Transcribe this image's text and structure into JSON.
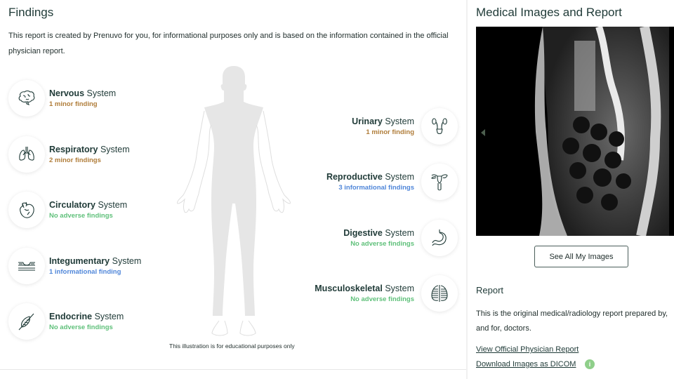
{
  "findings": {
    "title": "Findings",
    "intro": "This report is created by Prenuvo for you, for informational purposes only and is based on the information contained in the official physician report.",
    "illustration_caption": "This illustration is for educational purposes only",
    "systems": [
      {
        "name": "Nervous",
        "suffix": " System",
        "status": "1 minor finding",
        "status_type": "minor",
        "icon": "brain-icon"
      },
      {
        "name": "Respiratory",
        "suffix": " System",
        "status": "2 minor findings",
        "status_type": "minor",
        "icon": "lungs-icon"
      },
      {
        "name": "Circulatory",
        "suffix": " System",
        "status": "No adverse findings",
        "status_type": "ok",
        "icon": "heart-icon"
      },
      {
        "name": "Integumentary",
        "suffix": " System",
        "status": "1 informational finding",
        "status_type": "info",
        "icon": "skin-icon"
      },
      {
        "name": "Endocrine",
        "suffix": " System",
        "status": "No adverse findings",
        "status_type": "ok",
        "icon": "leaf-gland-icon"
      },
      {
        "name": "Urinary",
        "suffix": " System",
        "status": "1 minor finding",
        "status_type": "minor",
        "icon": "kidneys-icon"
      },
      {
        "name": "Reproductive",
        "suffix": " System",
        "status": "3 informational findings",
        "status_type": "info",
        "icon": "uterus-icon"
      },
      {
        "name": "Digestive",
        "suffix": " System",
        "status": "No adverse findings",
        "status_type": "ok",
        "icon": "stomach-icon"
      },
      {
        "name": "Musculoskeletal",
        "suffix": " System",
        "status": "No adverse findings",
        "status_type": "ok",
        "icon": "ribcage-icon"
      }
    ]
  },
  "medical": {
    "title": "Medical Images and Report",
    "see_all_label": "See All My Images",
    "report_title": "Report",
    "report_desc_line1": "This is the original medical/radiology report prepared by,",
    "report_desc_line2": "and for, doctors.",
    "view_report_link": "View Official Physician Report",
    "download_link": "Download Images as DICOM",
    "info_glyph": "i"
  },
  "colors": {
    "minor": "#b07d3a",
    "info": "#4f86d9",
    "ok": "#5fc07a",
    "text": "#1f3a37"
  }
}
